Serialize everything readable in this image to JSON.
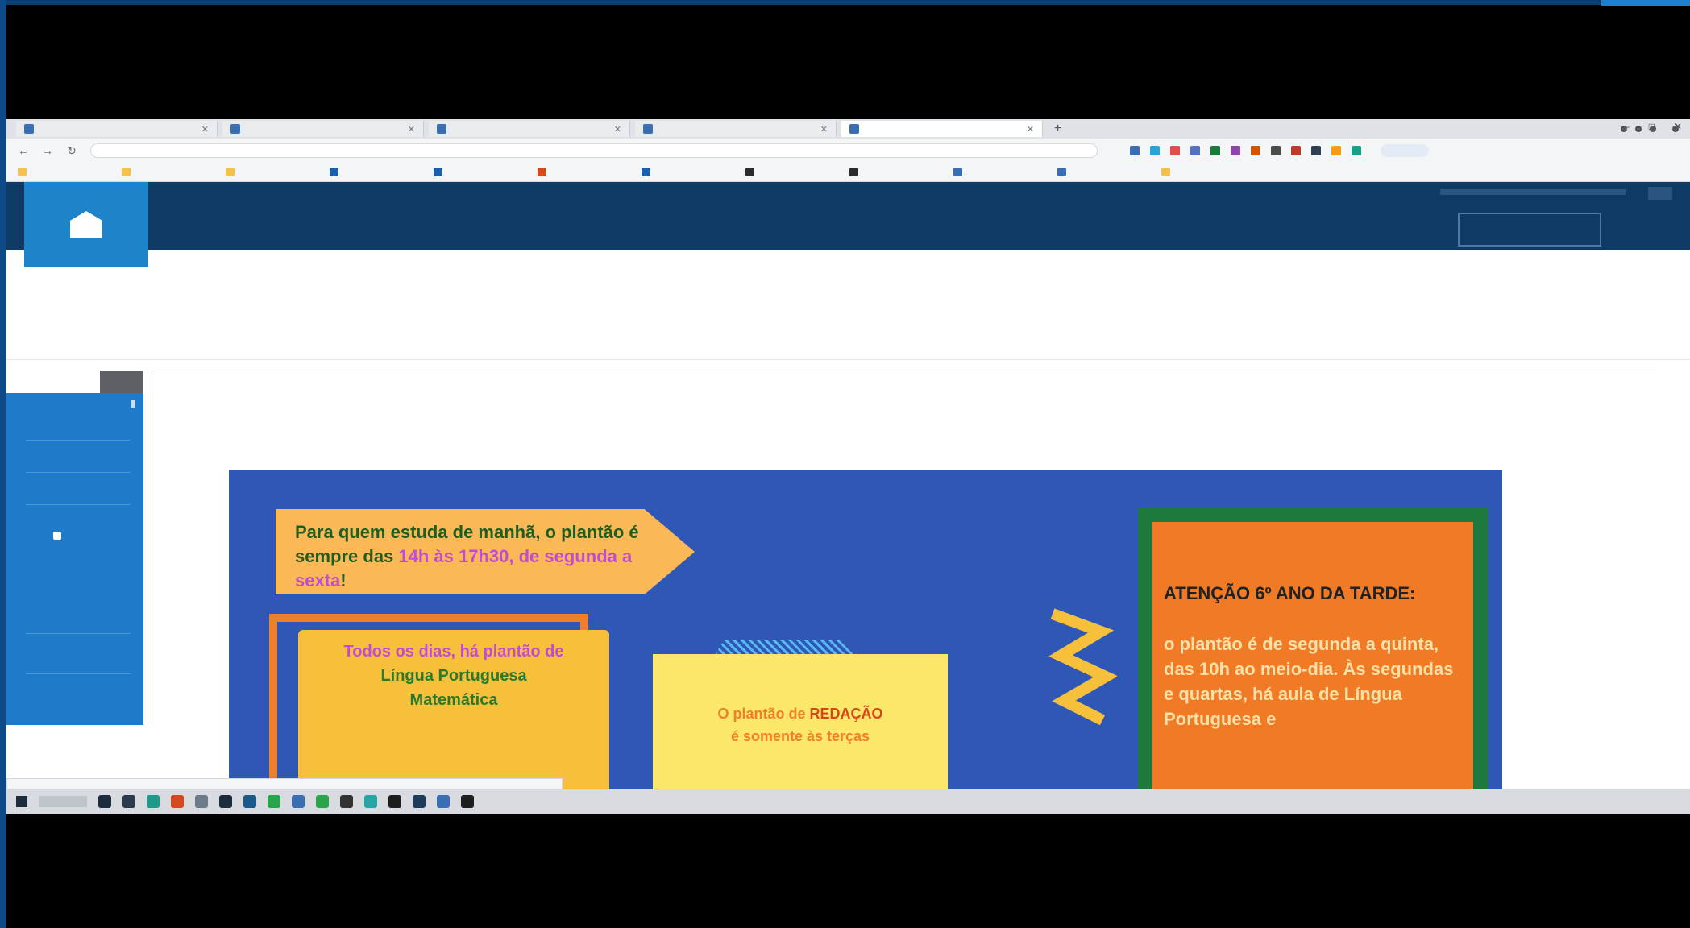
{
  "browser": {
    "tabs": [
      {
        "label": "",
        "active": false
      },
      {
        "label": "",
        "active": false
      },
      {
        "label": "",
        "active": false
      },
      {
        "label": "",
        "active": false
      },
      {
        "label": "",
        "active": true
      }
    ],
    "new_tab_label": "+",
    "window_controls": {
      "minimize": "–",
      "maximize": "□",
      "close": "✕"
    },
    "nav": {
      "back": "←",
      "forward": "→",
      "reload": "↻"
    },
    "address": "",
    "extension_colors": [
      "#3b6db3",
      "#2aa4d8",
      "#e44b4b",
      "#5470c4",
      "#1a7a3c",
      "#8e44ad",
      "#d35400",
      "#4b4b4b",
      "#c0392b",
      "#2c3e50",
      "#f39c12",
      "#16a085"
    ],
    "bookmarks": [
      {
        "label": "",
        "color": "#f2c24e"
      },
      {
        "label": "",
        "color": "#f2c24e"
      },
      {
        "label": "",
        "color": "#f2c24e"
      },
      {
        "label": "",
        "color": "#1d5fa8"
      },
      {
        "label": "",
        "color": "#1d5fa8"
      },
      {
        "label": "",
        "color": "#d24b1f"
      },
      {
        "label": "",
        "color": "#1d5fa8"
      },
      {
        "label": "",
        "color": "#2b2b2b"
      },
      {
        "label": "",
        "color": "#2b2b2b"
      },
      {
        "label": "",
        "color": "#3b6db3"
      },
      {
        "label": "",
        "color": "#3b6db3"
      },
      {
        "label": "",
        "color": "#f2c24e"
      }
    ]
  },
  "site": {
    "brand_color": "#103a66",
    "logo_color": "#1d84c9"
  },
  "banner": {
    "arrow_text_part1": "Para quem estuda de manhã, o plantão é sempre das ",
    "arrow_text_hl": "14h às 17h30, de segunda a sexta",
    "arrow_text_end": "!",
    "daily_line1": "Todos os dias, há plantão de",
    "daily_line2": "Língua Portuguesa",
    "daily_line3": "Matemática",
    "redacao_prefix": "O plantão de ",
    "redacao_strong": "REDAÇÃO",
    "redacao_line2": "é somente às terças",
    "attention_title": "ATENÇÃO 6º ANO DA TARDE:",
    "attention_body": "o plantão é de segunda a quinta, das 10h ao meio-dia. Às segundas e quartas, há aula de Língua Portuguesa e"
  },
  "taskbar": {
    "icon_colors": [
      "#1d2c3c",
      "#2b3a4a",
      "#1b9a8a",
      "#d24b1f",
      "#6b7b8b",
      "#1d2c3c",
      "#1a5a8a",
      "#2aa44a",
      "#3b6db3",
      "#2aa44a",
      "#333333",
      "#2aa4a4",
      "#1d1d1d",
      "#1d3c5c",
      "#3b6db3",
      "#1d1d1d"
    ]
  }
}
